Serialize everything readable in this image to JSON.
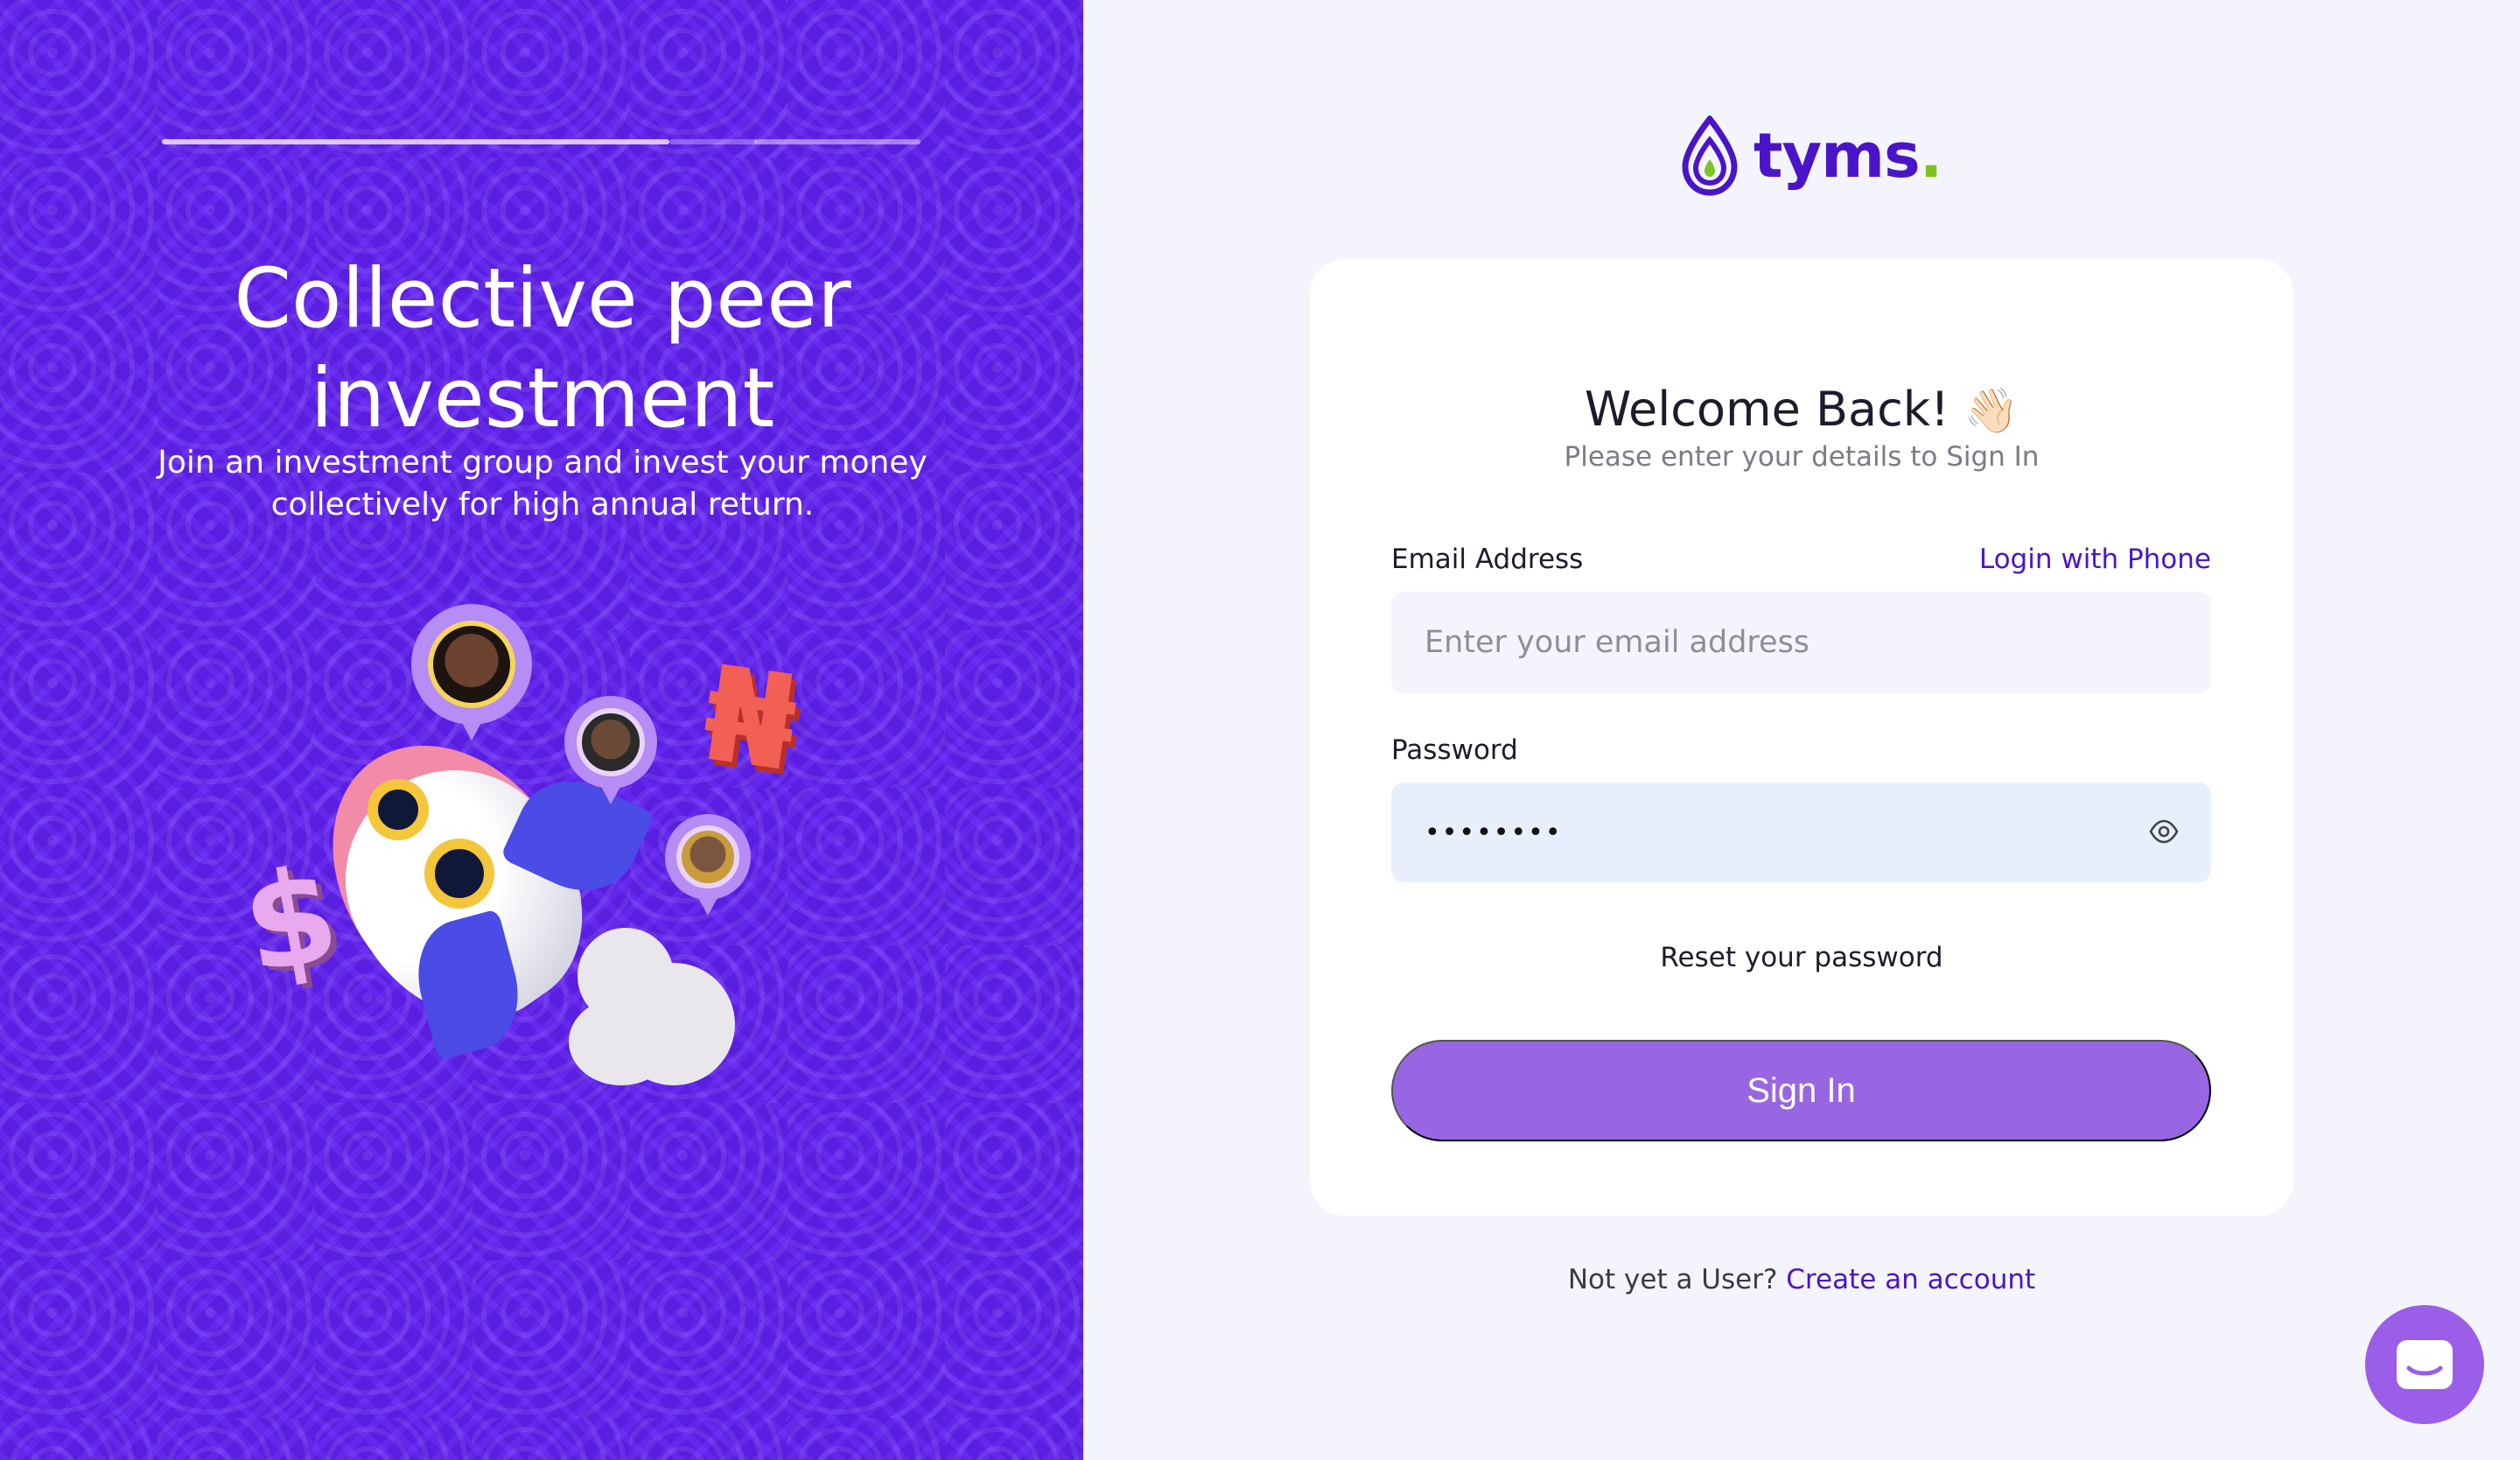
{
  "hero": {
    "title": "Collective peer investment",
    "subtitle": "Join an investment group and invest your money collectively for high annual return.",
    "naira_symbol": "₦",
    "dollar_symbol": "$"
  },
  "brand": {
    "name": "tyms",
    "dot": ".",
    "primary_color": "#4a15c9",
    "accent_color": "#7cc422",
    "panel_color": "#5a1ee0"
  },
  "form": {
    "heading": "Welcome Back!",
    "wave_emoji": "👋🏻",
    "subheading": "Please enter your details to Sign In",
    "email_label": "Email Address",
    "login_phone_link": "Login with Phone",
    "email_placeholder": "Enter your email address",
    "email_value": "",
    "password_label": "Password",
    "password_value": "••••••••",
    "reset_link": "Reset your password",
    "submit_label": "Sign In"
  },
  "footer": {
    "prompt": "Not yet a User?",
    "create_link": "Create an account"
  },
  "icons": {
    "password_toggle": "eye-icon",
    "chat_launcher": "chat-icon",
    "logo": "drop-logo-icon"
  }
}
